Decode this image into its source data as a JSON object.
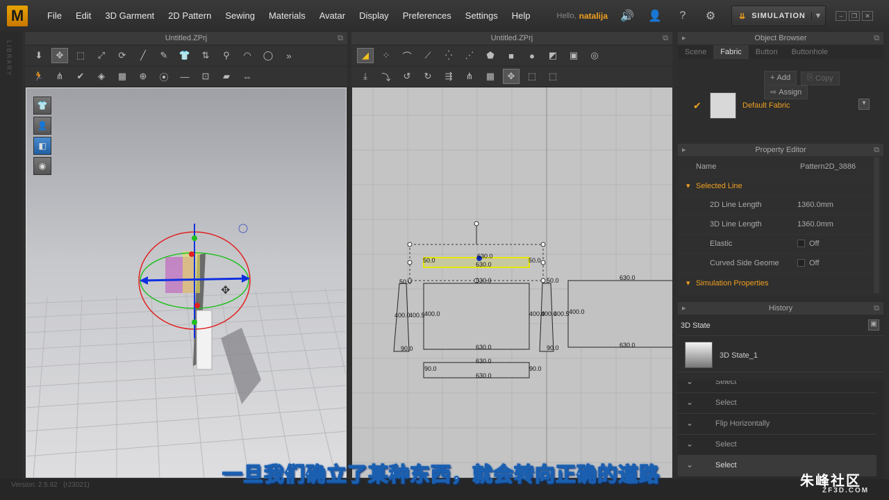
{
  "app": {
    "logo": "M"
  },
  "menu": [
    "File",
    "Edit",
    "3D Garment",
    "2D Pattern",
    "Sewing",
    "Materials",
    "Avatar",
    "Display",
    "Preferences",
    "Settings",
    "Help"
  ],
  "user": {
    "hello": "Hello,",
    "name": "natalija"
  },
  "simulation_button": "SIMULATION",
  "library_label": "LIBRARY",
  "panel3d": {
    "title": "Untitled.ZPrj"
  },
  "panel2d": {
    "title": "Untitled.ZPrj"
  },
  "pattern_labels": {
    "a": "50.0",
    "b": "50.0",
    "c": "630.0",
    "d": "630.0",
    "e": "630.0",
    "f": "50.0",
    "g": "50.0",
    "h": "400.0",
    "i": "400.5",
    "j": "400.0",
    "k": "90.0",
    "l": "630.0",
    "m": "400.0",
    "n": "400.0",
    "o": "400.5",
    "p": "90.0",
    "q": "630.0",
    "r": "630.0",
    "s": "400.0",
    "t": "90.0",
    "u": "630.0",
    "v": "90.0",
    "w": "630.0"
  },
  "object_browser": {
    "title": "Object Browser",
    "tabs": [
      "Scene",
      "Fabric",
      "Button",
      "Buttonhole"
    ],
    "active_tab": "Fabric",
    "buttons": {
      "add": "Add",
      "copy": "Copy",
      "assign": "Assign"
    },
    "fabric_item": "Default Fabric"
  },
  "property_editor": {
    "title": "Property Editor",
    "name_label": "Name",
    "name_value": "Pattern2D_3886",
    "section1": "Selected Line",
    "rows": [
      {
        "k": "2D Line Length",
        "v": "1360.0mm"
      },
      {
        "k": "3D Line Length",
        "v": "1360.0mm"
      },
      {
        "k": "Elastic",
        "v": "Off"
      },
      {
        "k": "Curved Side Geome",
        "v": "Off"
      }
    ],
    "section2": "Simulation Properties"
  },
  "history": {
    "title": "History",
    "state_header": "3D State",
    "state_item": "3D State_1",
    "items": [
      "Select",
      "Select",
      "Flip Horizontally",
      "Select",
      "Select"
    ]
  },
  "subtitle": "一旦我们确立了某种东西，就会转向正确的道路",
  "status": {
    "version": "Version: 2.5.92",
    "build": "(r23021)"
  },
  "watermark": {
    "line1": "朱峰社区",
    "line2": "ZF3D.COM"
  },
  "colors": {
    "accent": "#f0a020",
    "selected_line": "#e8e800",
    "gizmo_red": "#e02020",
    "gizmo_green": "#20c020",
    "gizmo_blue": "#1030e0"
  }
}
